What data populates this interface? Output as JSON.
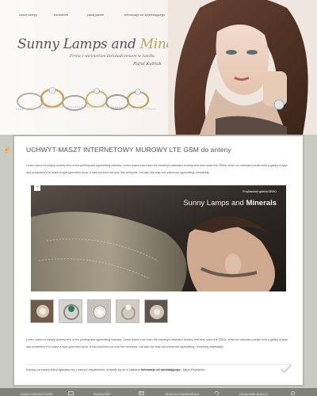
{
  "nav": {
    "items": [
      "nasze sklepy",
      "kontakt/ce",
      "zakaj jabnie",
      "Informacje od sprzedającego"
    ]
  },
  "brand": {
    "name_part1": "Sunny Lamps and ",
    "name_part2": "Minerals",
    "tagline": "Firma z wieloletnim doświadczeniem w handlu",
    "signature": "Rafał Kubiak",
    "accent_color": "#b9a862"
  },
  "product": {
    "title": "UCHWYT-MASZT INTERNETOWY MUROWY LTE GSM do anteny",
    "description_1": "Lorem Ipsum is simply dummy text of the printing and typesetting industry. Lorem Ipsum has been the industry's standard dummy text ever since the 1500s, when an unknown printer took a galley of type and scrambled it to make a type specimen book. It has survived not only five centuries, but also the leap into electronic typesetting, remaining",
    "description_2": "Lorem Ipsum is simply dummy text of the printing and typesetting industry. Lorem Ipsum has been the industry's standard dummy text ever since the 1500s, when an unknown printer took a galley of type and scrambled it to make a type specimen book. It has survived not only five centuries, but also the leap into electronic typesetting, remaining essentially"
  },
  "hero": {
    "small_label": "Przykładowa galeria DEMO",
    "title_part1": "Sunny Lamps and ",
    "title_part2": "Minerals",
    "add_icon_glyph": "+"
  },
  "thumbnails": [
    "thumb-1",
    "thumb-2",
    "thumb-3",
    "thumb-4",
    "thumb-5"
  ],
  "agreement": {
    "text_before": "Kupując na naszej aukcji zgadzasz się z naszym regulaminem, znajduje się on w zakładce ",
    "link": "Informacje od sprzedającego",
    "text_after": " - zakaz Regulamin."
  },
  "footer": {
    "items": [
      "DANE KONTAKTOWE",
      "PŁATNOŚĆ",
      "ZDJĘCIA ZAMÓWIENIA",
      "DZIAŁANIE AUKCJI"
    ]
  },
  "colors": {
    "background": "#c9cac2",
    "panel_border": "#b5b8ad",
    "footer": "#7f8278"
  }
}
